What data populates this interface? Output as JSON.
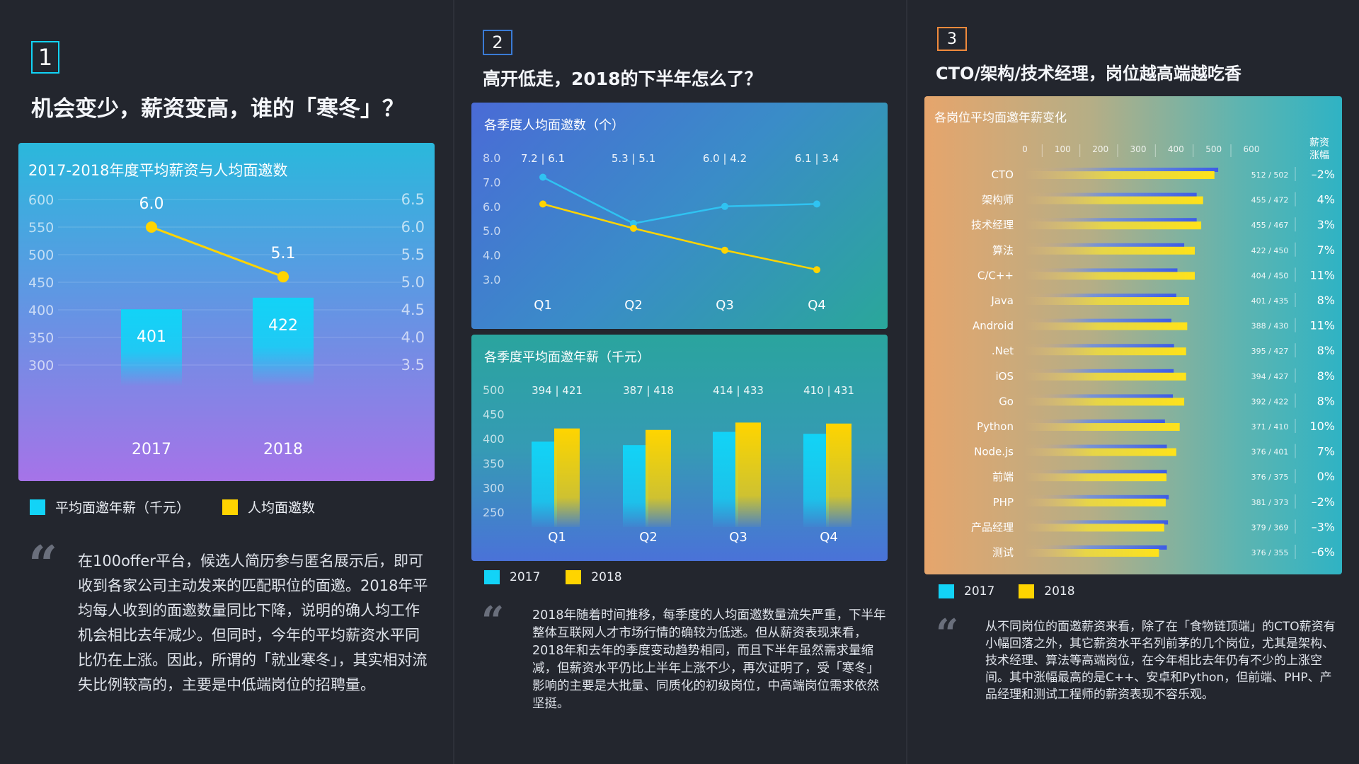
{
  "colors": {
    "cyan": "#12d3f7",
    "yellow": "#ffd400",
    "blue_line": "#2fc3f2",
    "bg": "#23262e"
  },
  "section1": {
    "number": "1",
    "title": "机会变少，薪资变高，谁的「寒冬」？",
    "chart_data": {
      "type": "bar",
      "title": "2017-2018年度平均薪资与人均面邀数",
      "categories": [
        "2017",
        "2018"
      ],
      "series": [
        {
          "name": "平均面邀年薪（千元）",
          "values": [
            401,
            422
          ],
          "axis": "left"
        },
        {
          "name": "人均面邀数",
          "values": [
            6.0,
            5.1
          ],
          "axis": "right",
          "type": "line"
        }
      ],
      "y_left_ticks": [
        "600",
        "550",
        "500",
        "450",
        "400",
        "350",
        "300"
      ],
      "y_right_ticks": [
        "6.5",
        "6.0",
        "5.5",
        "5.0",
        "4.5",
        "4.0",
        "3.5"
      ],
      "ylim_left": [
        300,
        600
      ],
      "ylim_right": [
        3.5,
        6.5
      ],
      "bar_labels": [
        "401",
        "422"
      ],
      "line_labels": [
        "6.0",
        "5.1"
      ]
    },
    "legend": [
      "平均面邀年薪（千元）",
      "人均面邀数"
    ],
    "paragraph": "在100offer平台，候选人简历参与匿名展示后，即可收到各家公司主动发来的匹配职位的面邀。2018年平均每人收到的面邀数量同比下降，说明的确人均工作机会相比去年减少。但同时，今年的平均薪资水平同比仍在上涨。因此，所谓的「就业寒冬」，其实相对流失比例较高的，主要是中低端岗位的招聘量。"
  },
  "section2": {
    "number": "2",
    "title": "高开低走，2018的下半年怎么了？",
    "chart_data": [
      {
        "type": "line",
        "title": "各季度人均面邀数（个）",
        "categories": [
          "Q1",
          "Q2",
          "Q3",
          "Q4"
        ],
        "series": [
          {
            "name": "2017",
            "values": [
              7.2,
              5.3,
              6.0,
              6.1
            ]
          },
          {
            "name": "2018",
            "values": [
              6.1,
              5.1,
              4.2,
              3.4
            ]
          }
        ],
        "top_labels": [
          "7.2 | 6.1",
          "5.3 | 5.1",
          "6.0 | 4.2",
          "6.1 | 3.4"
        ],
        "y_ticks": [
          "8.0",
          "7.0",
          "6.0",
          "5.0",
          "4.0",
          "3.0"
        ],
        "ylim": [
          3.0,
          8.0
        ]
      },
      {
        "type": "bar",
        "title": "各季度平均面邀年薪（千元）",
        "categories": [
          "Q1",
          "Q2",
          "Q3",
          "Q4"
        ],
        "series": [
          {
            "name": "2017",
            "values": [
              394,
              387,
              414,
              410
            ]
          },
          {
            "name": "2018",
            "values": [
              421,
              418,
              433,
              431
            ]
          }
        ],
        "top_labels": [
          "394 | 421",
          "387 | 418",
          "414 | 433",
          "410 | 431"
        ],
        "y_ticks": [
          "500",
          "450",
          "400",
          "350",
          "300",
          "250"
        ],
        "ylim": [
          250,
          500
        ]
      }
    ],
    "legend": [
      "2017",
      "2018"
    ],
    "paragraph": "2018年随着时间推移，每季度的人均面邀数量流失严重，下半年整体互联网人才市场行情的确较为低迷。但从薪资表现来看，2018年和去年的季度变动趋势相同，而且下半年虽然需求量缩减，但薪资水平仍比上半年上涨不少，再次证明了，受「寒冬」影响的主要是大批量、同质化的初级岗位，中高端岗位需求依然坚挺。"
  },
  "section3": {
    "number": "3",
    "title": "CTO/架构/技术经理，岗位越高端越吃香",
    "chart_data": {
      "type": "bar",
      "orientation": "horizontal",
      "title": "各岗位平均面邀年薪变化",
      "x_ticks": [
        "0",
        "100",
        "200",
        "300",
        "400",
        "500",
        "600"
      ],
      "xlim": [
        0,
        600
      ],
      "change_header": "薪资涨幅",
      "categories": [
        "CTO",
        "架构师",
        "技术经理",
        "算法",
        "C/C++",
        "Java",
        "Android",
        ".Net",
        "iOS",
        "Go",
        "Python",
        "Node.js",
        "前端",
        "PHP",
        "产品经理",
        "测试"
      ],
      "series": [
        {
          "name": "2017",
          "values": [
            512,
            455,
            455,
            422,
            404,
            401,
            388,
            395,
            394,
            392,
            371,
            376,
            376,
            381,
            379,
            376
          ]
        },
        {
          "name": "2018",
          "values": [
            502,
            472,
            467,
            450,
            450,
            435,
            430,
            427,
            427,
            422,
            410,
            401,
            375,
            373,
            369,
            355
          ]
        }
      ],
      "pair_labels": [
        "512 / 502",
        "455 / 472",
        "455 / 467",
        "422 / 450",
        "404 / 450",
        "401 / 435",
        "388 / 430",
        "395 / 427",
        "394 / 427",
        "392 / 422",
        "371 / 410",
        "376 / 401",
        "376 / 375",
        "381 / 373",
        "379 / 369",
        "376 / 355"
      ],
      "changes": [
        "–2%",
        "4%",
        "3%",
        "7%",
        "11%",
        "8%",
        "11%",
        "8%",
        "8%",
        "8%",
        "10%",
        "7%",
        "0%",
        "–2%",
        "–3%",
        "–6%"
      ]
    },
    "legend": [
      "2017",
      "2018"
    ],
    "paragraph": "从不同岗位的面邀薪资来看，除了在「食物链顶端」的CTO薪资有小幅回落之外，其它薪资水平名列前茅的几个岗位，尤其是架构、技术经理、算法等高端岗位，在今年相比去年仍有不少的上涨空间。其中涨幅最高的是C++、安卓和Python，但前端、PHP、产品经理和测试工程师的薪资表现不容乐观。"
  }
}
